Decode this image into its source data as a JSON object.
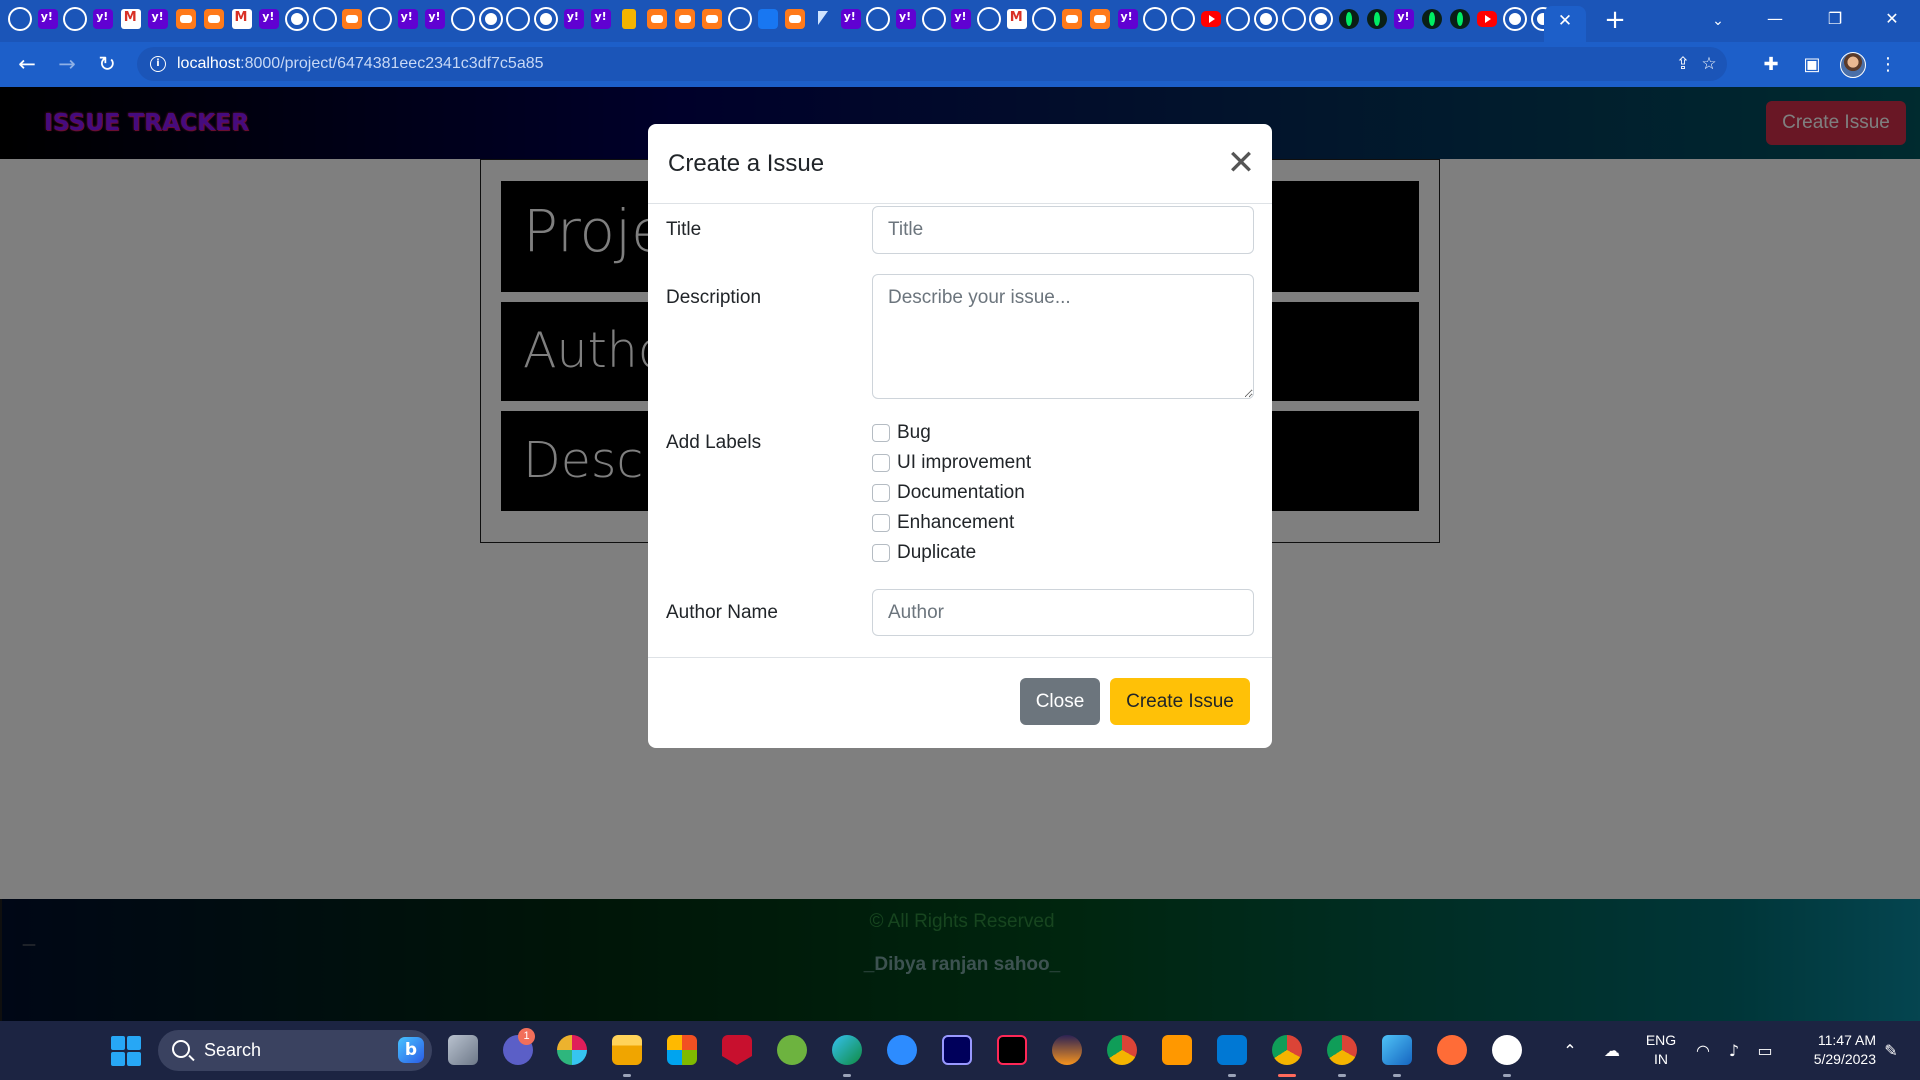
{
  "browser": {
    "favicons": [
      "github",
      "yahoo",
      "github",
      "yahoo",
      "gmail",
      "yahoo",
      "coding",
      "coding",
      "gmail",
      "yahoo",
      "globe",
      "github",
      "coding",
      "github",
      "yahoo",
      "yahoo",
      "github",
      "globe",
      "github",
      "globe",
      "yahoo",
      "yahoo",
      "trophy",
      "coding",
      "coding",
      "coding",
      "github",
      "fb",
      "coding",
      "cursor",
      "yahoo",
      "github",
      "yahoo",
      "github",
      "yahoo",
      "github",
      "gmail",
      "github",
      "coding",
      "coding",
      "yahoo",
      "github",
      "github",
      "youtube",
      "github",
      "globe",
      "github",
      "globe",
      "mongo",
      "mongo",
      "yahoo",
      "mongo",
      "mongo",
      "youtube",
      "globe",
      "globe"
    ],
    "tab_close_icon": "close-icon",
    "new_tab_icon": "plus-icon",
    "url_host": "localhost",
    "url_path": ":8000/project/6474381eec2341c3df7c5a85"
  },
  "app": {
    "brand": "ISSUE TRACKER",
    "create_button": "Create Issue"
  },
  "project_card": {
    "project_text": "Proje",
    "author_text": "Autho",
    "description_text": "Descri"
  },
  "footer": {
    "dash": "—",
    "rights": "© All Rights Reserved",
    "author": "_Dibya ranjan sahoo_"
  },
  "modal": {
    "title": "Create a Issue",
    "close_symbol": "✕",
    "title_label": "Title",
    "title_placeholder": "Title",
    "description_label": "Description",
    "description_placeholder": "Describe your issue...",
    "labels_label": "Add Labels",
    "labels": [
      "Bug",
      "UI improvement",
      "Documentation",
      "Enhancement",
      "Duplicate"
    ],
    "author_label": "Author Name",
    "author_placeholder": "Author",
    "close_button": "Close",
    "create_button": "Create Issue"
  },
  "taskbar": {
    "search_text": "Search",
    "bing_letter": "b",
    "teams_badge": "1",
    "lang_line1": "ENG",
    "lang_line2": "IN",
    "time": "11:47 AM",
    "date": "5/29/2023"
  },
  "colors": {
    "tabstrip": "#1b55b8",
    "toolbar": "#1d5fc9",
    "brand": "#8a17ff",
    "danger": "#d32f4b",
    "warning": "#ffc107",
    "secondary": "#6c757d"
  }
}
